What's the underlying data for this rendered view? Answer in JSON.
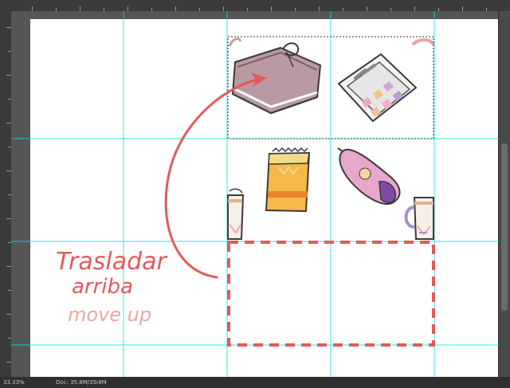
{
  "annotation": {
    "spanish_text_line1": "Trasladar",
    "spanish_text_line2": "arriba",
    "english_text": "move up"
  },
  "status": {
    "zoom": "33.33%",
    "doc_info": "Doc: 35.8M/35.8M"
  },
  "colors": {
    "guide": "#00e6e6",
    "annotation_red": "#e35a5a",
    "annotation_pink": "#f0a3a3",
    "workspace": "#5a5a5a",
    "artboard": "#ffffff"
  },
  "tiles": [
    {
      "name": "notebook-with-ribbon",
      "selected": true
    },
    {
      "name": "eyeshadow-palette",
      "selected": true
    },
    {
      "name": "notepad",
      "selected": false
    },
    {
      "name": "pink-pencil-case",
      "selected": false
    },
    {
      "name": "mug-left-half",
      "selected": false
    },
    {
      "name": "mug-right-half",
      "selected": false
    }
  ]
}
